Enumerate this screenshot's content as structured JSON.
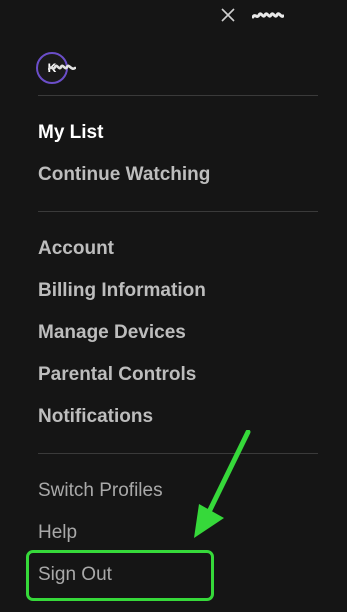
{
  "header": {
    "close_icon": "close-icon",
    "profile_name_redacted": true
  },
  "profile": {
    "avatar_initial": "K"
  },
  "sections": {
    "library": [
      {
        "label": "My List"
      },
      {
        "label": "Continue Watching"
      }
    ],
    "account": [
      {
        "label": "Account"
      },
      {
        "label": "Billing Information"
      },
      {
        "label": "Manage Devices"
      },
      {
        "label": "Parental Controls"
      },
      {
        "label": "Notifications"
      }
    ],
    "misc": [
      {
        "label": "Switch Profiles"
      },
      {
        "label": "Help"
      },
      {
        "label": "Sign Out"
      }
    ]
  },
  "annotation": {
    "highlight_color": "#36d93a",
    "arrow_icon": "arrow-down-left-icon"
  },
  "colors": {
    "background": "#151515",
    "avatar_ring": "#6b4ec9",
    "divider": "#3a3a3a"
  }
}
